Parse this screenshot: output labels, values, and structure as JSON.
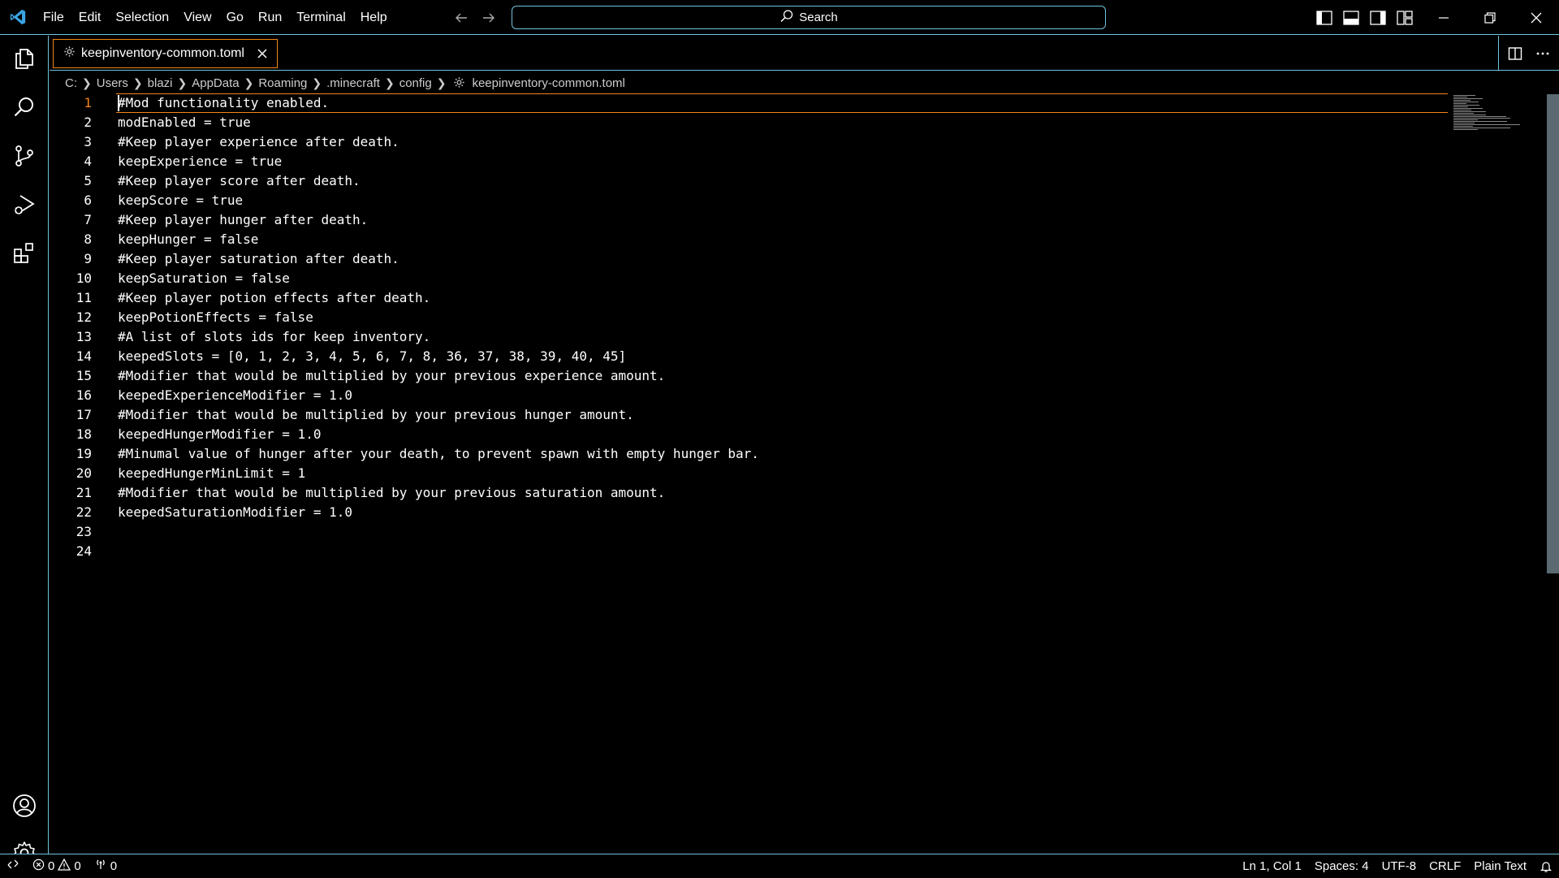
{
  "menu": [
    "File",
    "Edit",
    "Selection",
    "View",
    "Go",
    "Run",
    "Terminal",
    "Help"
  ],
  "search": {
    "label": "Search"
  },
  "tab": {
    "title": "keepinventory-common.toml"
  },
  "breadcrumbs": [
    "C:",
    "Users",
    "blazi",
    "AppData",
    "Roaming",
    ".minecraft",
    "config",
    "keepinventory-common.toml"
  ],
  "editor": {
    "active_line": 1,
    "lines": [
      {
        "n": "1",
        "text": "#Mod functionality enabled."
      },
      {
        "n": "2",
        "text": "modEnabled = true"
      },
      {
        "n": "3",
        "text": "#Keep player experience after death."
      },
      {
        "n": "4",
        "text": "keepExperience = true"
      },
      {
        "n": "5",
        "text": "#Keep player score after death."
      },
      {
        "n": "6",
        "text": "keepScore = true"
      },
      {
        "n": "7",
        "text": "#Keep player hunger after death."
      },
      {
        "n": "8",
        "text": "keepHunger = false"
      },
      {
        "n": "9",
        "text": "#Keep player saturation after death."
      },
      {
        "n": "10",
        "text": "keepSaturation = false"
      },
      {
        "n": "11",
        "text": "#Keep player potion effects after death."
      },
      {
        "n": "12",
        "text": "keepPotionEffects = false"
      },
      {
        "n": "13",
        "text": "#A list of slots ids for keep inventory."
      },
      {
        "n": "14",
        "text": "keepedSlots = [0, 1, 2, 3, 4, 5, 6, 7, 8, 36, 37, 38, 39, 40, 45]"
      },
      {
        "n": "15",
        "text": "#Modifier that would be multiplied by your previous experience amount."
      },
      {
        "n": "16",
        "text": "keepedExperienceModifier = 1.0"
      },
      {
        "n": "17",
        "text": "#Modifier that would be multiplied by your previous hunger amount."
      },
      {
        "n": "18",
        "text": "keepedHungerModifier = 1.0"
      },
      {
        "n": "19",
        "text": "#Minumal value of hunger after your death, to prevent spawn with empty hunger bar."
      },
      {
        "n": "20",
        "text": "keepedHungerMinLimit = 1"
      },
      {
        "n": "21",
        "text": "#Modifier that would be multiplied by your previous saturation amount."
      },
      {
        "n": "22",
        "text": "keepedSaturationModifier = 1.0"
      },
      {
        "n": "23",
        "text": ""
      },
      {
        "n": "24",
        "text": ""
      }
    ]
  },
  "status": {
    "errors": "0",
    "warnings": "0",
    "ports": "0",
    "position": "Ln 1, Col 1",
    "spaces": "Spaces: 4",
    "encoding": "UTF-8",
    "eol": "CRLF",
    "language": "Plain Text"
  },
  "colors": {
    "border": "#6fc3df",
    "focus": "#f38518",
    "logo": "#3ba3e3"
  }
}
